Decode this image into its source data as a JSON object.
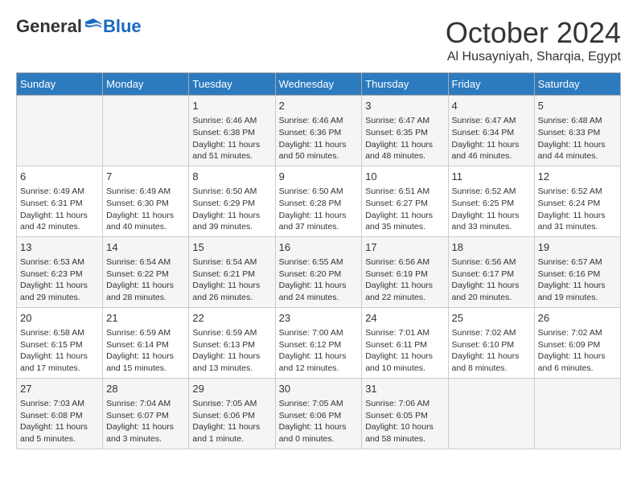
{
  "logo": {
    "general": "General",
    "blue": "Blue"
  },
  "title": {
    "month_year": "October 2024",
    "location": "Al Husayniyah, Sharqia, Egypt"
  },
  "days_of_week": [
    "Sunday",
    "Monday",
    "Tuesday",
    "Wednesday",
    "Thursday",
    "Friday",
    "Saturday"
  ],
  "weeks": [
    [
      {
        "day": "",
        "content": ""
      },
      {
        "day": "",
        "content": ""
      },
      {
        "day": "1",
        "content": "Sunrise: 6:46 AM\nSunset: 6:38 PM\nDaylight: 11 hours and 51 minutes."
      },
      {
        "day": "2",
        "content": "Sunrise: 6:46 AM\nSunset: 6:36 PM\nDaylight: 11 hours and 50 minutes."
      },
      {
        "day": "3",
        "content": "Sunrise: 6:47 AM\nSunset: 6:35 PM\nDaylight: 11 hours and 48 minutes."
      },
      {
        "day": "4",
        "content": "Sunrise: 6:47 AM\nSunset: 6:34 PM\nDaylight: 11 hours and 46 minutes."
      },
      {
        "day": "5",
        "content": "Sunrise: 6:48 AM\nSunset: 6:33 PM\nDaylight: 11 hours and 44 minutes."
      }
    ],
    [
      {
        "day": "6",
        "content": "Sunrise: 6:49 AM\nSunset: 6:31 PM\nDaylight: 11 hours and 42 minutes."
      },
      {
        "day": "7",
        "content": "Sunrise: 6:49 AM\nSunset: 6:30 PM\nDaylight: 11 hours and 40 minutes."
      },
      {
        "day": "8",
        "content": "Sunrise: 6:50 AM\nSunset: 6:29 PM\nDaylight: 11 hours and 39 minutes."
      },
      {
        "day": "9",
        "content": "Sunrise: 6:50 AM\nSunset: 6:28 PM\nDaylight: 11 hours and 37 minutes."
      },
      {
        "day": "10",
        "content": "Sunrise: 6:51 AM\nSunset: 6:27 PM\nDaylight: 11 hours and 35 minutes."
      },
      {
        "day": "11",
        "content": "Sunrise: 6:52 AM\nSunset: 6:25 PM\nDaylight: 11 hours and 33 minutes."
      },
      {
        "day": "12",
        "content": "Sunrise: 6:52 AM\nSunset: 6:24 PM\nDaylight: 11 hours and 31 minutes."
      }
    ],
    [
      {
        "day": "13",
        "content": "Sunrise: 6:53 AM\nSunset: 6:23 PM\nDaylight: 11 hours and 29 minutes."
      },
      {
        "day": "14",
        "content": "Sunrise: 6:54 AM\nSunset: 6:22 PM\nDaylight: 11 hours and 28 minutes."
      },
      {
        "day": "15",
        "content": "Sunrise: 6:54 AM\nSunset: 6:21 PM\nDaylight: 11 hours and 26 minutes."
      },
      {
        "day": "16",
        "content": "Sunrise: 6:55 AM\nSunset: 6:20 PM\nDaylight: 11 hours and 24 minutes."
      },
      {
        "day": "17",
        "content": "Sunrise: 6:56 AM\nSunset: 6:19 PM\nDaylight: 11 hours and 22 minutes."
      },
      {
        "day": "18",
        "content": "Sunrise: 6:56 AM\nSunset: 6:17 PM\nDaylight: 11 hours and 20 minutes."
      },
      {
        "day": "19",
        "content": "Sunrise: 6:57 AM\nSunset: 6:16 PM\nDaylight: 11 hours and 19 minutes."
      }
    ],
    [
      {
        "day": "20",
        "content": "Sunrise: 6:58 AM\nSunset: 6:15 PM\nDaylight: 11 hours and 17 minutes."
      },
      {
        "day": "21",
        "content": "Sunrise: 6:59 AM\nSunset: 6:14 PM\nDaylight: 11 hours and 15 minutes."
      },
      {
        "day": "22",
        "content": "Sunrise: 6:59 AM\nSunset: 6:13 PM\nDaylight: 11 hours and 13 minutes."
      },
      {
        "day": "23",
        "content": "Sunrise: 7:00 AM\nSunset: 6:12 PM\nDaylight: 11 hours and 12 minutes."
      },
      {
        "day": "24",
        "content": "Sunrise: 7:01 AM\nSunset: 6:11 PM\nDaylight: 11 hours and 10 minutes."
      },
      {
        "day": "25",
        "content": "Sunrise: 7:02 AM\nSunset: 6:10 PM\nDaylight: 11 hours and 8 minutes."
      },
      {
        "day": "26",
        "content": "Sunrise: 7:02 AM\nSunset: 6:09 PM\nDaylight: 11 hours and 6 minutes."
      }
    ],
    [
      {
        "day": "27",
        "content": "Sunrise: 7:03 AM\nSunset: 6:08 PM\nDaylight: 11 hours and 5 minutes."
      },
      {
        "day": "28",
        "content": "Sunrise: 7:04 AM\nSunset: 6:07 PM\nDaylight: 11 hours and 3 minutes."
      },
      {
        "day": "29",
        "content": "Sunrise: 7:05 AM\nSunset: 6:06 PM\nDaylight: 11 hours and 1 minute."
      },
      {
        "day": "30",
        "content": "Sunrise: 7:05 AM\nSunset: 6:06 PM\nDaylight: 11 hours and 0 minutes."
      },
      {
        "day": "31",
        "content": "Sunrise: 7:06 AM\nSunset: 6:05 PM\nDaylight: 10 hours and 58 minutes."
      },
      {
        "day": "",
        "content": ""
      },
      {
        "day": "",
        "content": ""
      }
    ]
  ]
}
